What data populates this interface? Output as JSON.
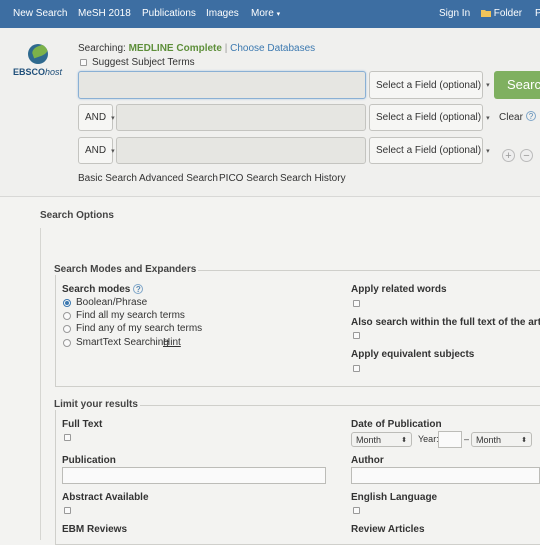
{
  "topnav": {
    "items": [
      "New Search",
      "MeSH 2018",
      "Publications",
      "Images",
      "More"
    ],
    "more_caret": "▾",
    "signin": "Sign In",
    "folder": "Folder",
    "prefs_partial": "P"
  },
  "logo": {
    "text_ebsco": "EBSCO",
    "text_host": "host"
  },
  "search": {
    "searching_label": "Searching:",
    "database": "MEDLINE Complete",
    "choose_databases": "Choose Databases",
    "suggest_subject_terms": "Suggest Subject Terms",
    "rows": [
      {
        "operator": "",
        "field": "Select a Field (optional)",
        "value": ""
      },
      {
        "operator": "AND",
        "field": "Select a Field (optional)",
        "value": ""
      },
      {
        "operator": "AND",
        "field": "Select a Field (optional)",
        "value": ""
      }
    ],
    "search_button": "Searc",
    "clear": "Clear",
    "help_q": "?",
    "add": "+",
    "remove": "−",
    "links": [
      "Basic Search",
      "Advanced Search",
      "PICO Search",
      "Search History"
    ]
  },
  "options": {
    "title": "Search Options",
    "modes_section": "Search Modes and Expanders",
    "search_modes_label": "Search modes",
    "modes": [
      {
        "label": "Boolean/Phrase",
        "selected": true
      },
      {
        "label": "Find all my search terms",
        "selected": false
      },
      {
        "label": "Find any of my search terms",
        "selected": false
      },
      {
        "label": "SmartText Searching",
        "selected": false
      }
    ],
    "hint": "Hint",
    "apply_related_words": "Apply related words",
    "also_search_fulltext": "Also search within the full text of the articles",
    "apply_equivalent_subjects": "Apply equivalent subjects",
    "limit_section": "Limit your results",
    "full_text": "Full Text",
    "date_of_publication": "Date of Publication",
    "month": "Month",
    "year": "Year:",
    "dash": "–",
    "publication": "Publication",
    "author": "Author",
    "abstract_available": "Abstract Available",
    "english_language": "English Language",
    "ebm_reviews": "EBM Reviews",
    "review_articles": "Review Articles"
  }
}
